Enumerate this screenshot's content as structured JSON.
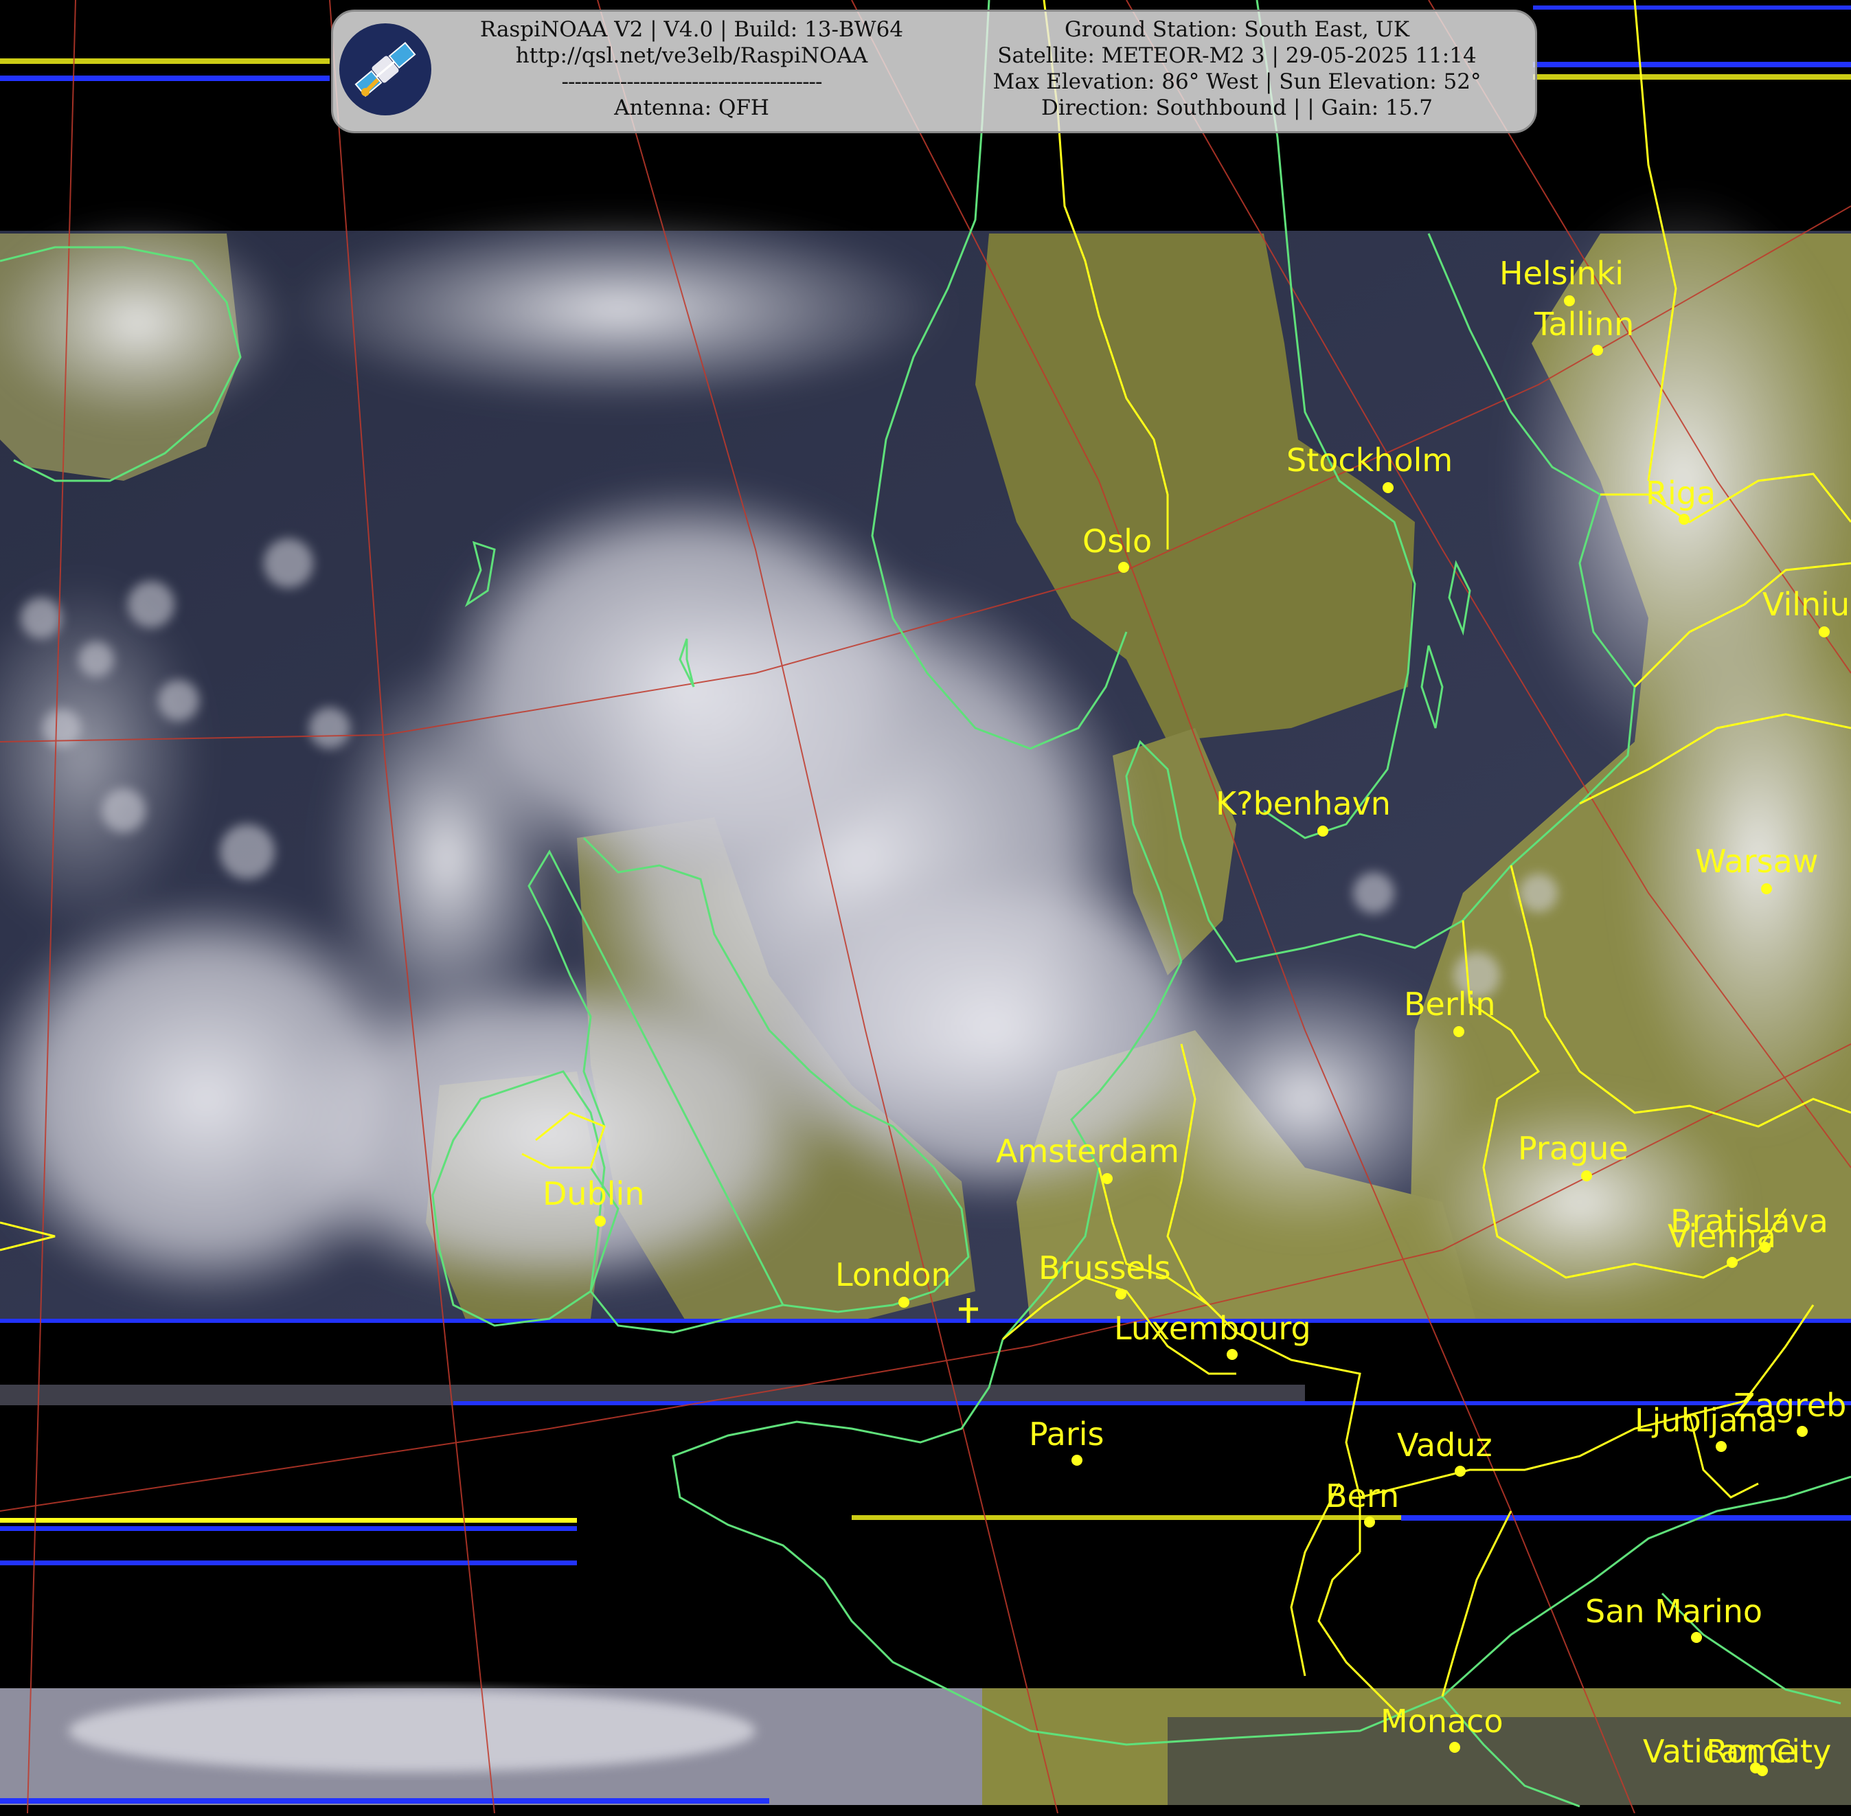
{
  "header": {
    "left_lines": [
      "RaspiNOAA V2 | V4.0 | Build: 13-BW64",
      "http://qsl.net/ve3elb/RaspiNOAA",
      "----------------------------------------",
      "Antenna: QFH"
    ],
    "right_lines": [
      "Ground Station: South East, UK",
      "Satellite: METEOR-M2 3 | 29-05-2025 11:14",
      "Max Elevation: 86° West | Sun Elevation: 52°",
      "Direction: Southbound | | Gain: 15.7"
    ],
    "logo_icon": "satellite-icon"
  },
  "cities": [
    {
      "name": "Helsinki"
    },
    {
      "name": "Tallinn"
    },
    {
      "name": "Stockholm"
    },
    {
      "name": "Riga"
    },
    {
      "name": "Oslo"
    },
    {
      "name": "Vilnius"
    },
    {
      "name": "K?benhavn"
    },
    {
      "name": "Warsaw"
    },
    {
      "name": "Berlin"
    },
    {
      "name": "Amsterdam"
    },
    {
      "name": "Prague"
    },
    {
      "name": "Dublin"
    },
    {
      "name": "Bratislava"
    },
    {
      "name": "Vienna"
    },
    {
      "name": "London"
    },
    {
      "name": "Brussels"
    },
    {
      "name": "Luxembourg"
    },
    {
      "name": "Paris"
    },
    {
      "name": "Zagreb"
    },
    {
      "name": "Ljubljana"
    },
    {
      "name": "Vaduz"
    },
    {
      "name": "Bern"
    },
    {
      "name": "San Marino"
    },
    {
      "name": "Monaco"
    },
    {
      "name": "Vatican City"
    },
    {
      "name": "Rome"
    }
  ],
  "colors": {
    "coastline": "#5fe07a",
    "border": "#ffff1a",
    "graticule": "#c0392b",
    "label": "#ffff1a"
  }
}
